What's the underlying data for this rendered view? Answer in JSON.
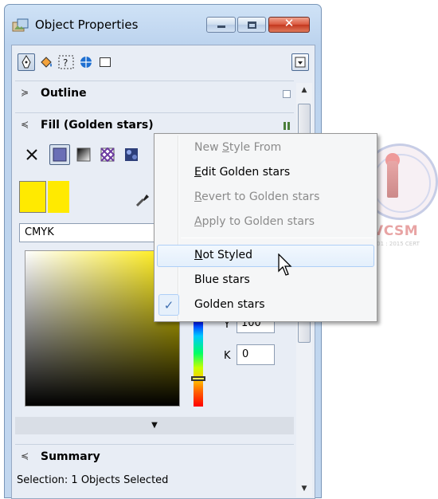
{
  "window": {
    "title": "Object Properties",
    "close_glyph": "✕"
  },
  "toolbar": {
    "icons": [
      "outline-pen-icon",
      "fill-bucket-icon",
      "character-icon",
      "internet-icon",
      "frame-icon"
    ],
    "menu_icon": "flyout-menu-icon"
  },
  "sections": {
    "outline": {
      "chevron": "≽",
      "title": "Outline"
    },
    "fill": {
      "chevron": "≼",
      "title": "Fill (Golden stars)"
    },
    "summary": {
      "chevron": "≼",
      "title": "Summary",
      "status": "Selection: 1 Objects Selected"
    }
  },
  "fill": {
    "types": [
      "no-fill-icon",
      "uniform-fill-icon",
      "fountain-fill-icon",
      "vector-pattern-icon",
      "bitmap-pattern-icon"
    ],
    "swatch_color": "#ffea00",
    "color_model": "CMYK",
    "y_label": "Y",
    "y_value": "100",
    "k_label": "K",
    "k_value": "0",
    "expand_glyph": "▼"
  },
  "context_menu": {
    "items": [
      {
        "label_u": "New ",
        "label_k": "S",
        "label_r": "tyle From",
        "disabled": true
      },
      {
        "label_u": "",
        "label_k": "E",
        "label_r": "dit Golden stars",
        "disabled": false
      },
      {
        "label_u": "",
        "label_k": "R",
        "label_r": "evert to Golden stars",
        "disabled": true
      },
      {
        "label_u": "",
        "label_k": "A",
        "label_r": "pply to Golden stars",
        "disabled": true
      },
      {
        "label_u": "",
        "label_k": "N",
        "label_r": "ot Styled",
        "disabled": false,
        "hover": true
      },
      {
        "label_u": "",
        "label_k": "",
        "label_r": "Blue stars",
        "disabled": false
      },
      {
        "label_u": "",
        "label_k": "",
        "label_r": "Golden stars",
        "disabled": false,
        "checked": true
      }
    ],
    "check_glyph": "✓"
  },
  "watermark": {
    "text": "RGVCSM",
    "subtext": "ISO 9001 : 2015 CERT"
  }
}
